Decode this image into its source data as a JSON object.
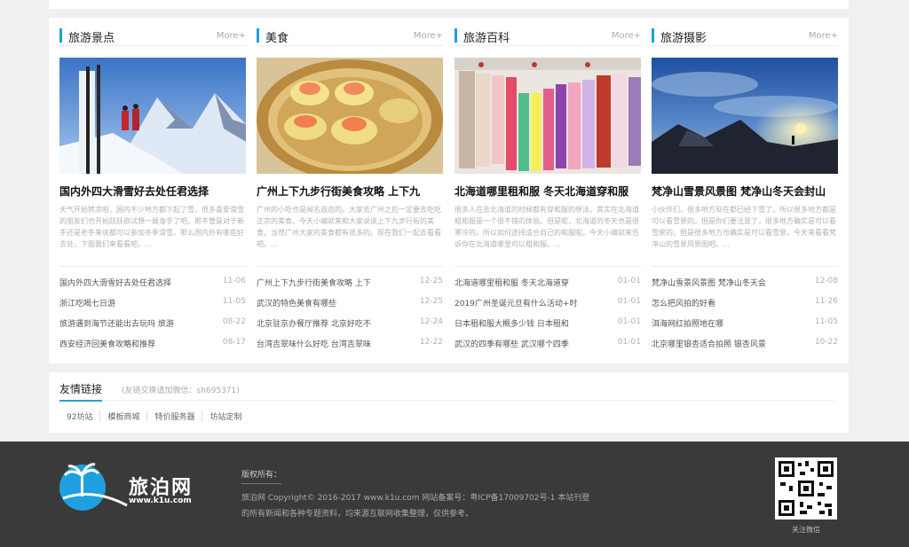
{
  "columns": [
    {
      "title": "旅游景点",
      "more": "More+",
      "headline": "国内外四大滑雪好去处任君选择",
      "summary": "天气开始转凉啦，国内不少地方都下起了雪，很多喜爱滑雪的朋友们也开始跃跃欲试想一展身手了吧。那不管是对于新手还是老手来说都可以参加冬季滑雪。那么国内外有哪些好去处，下面我们来看看吧。...",
      "list": [
        {
          "title": "国内外四大滑雪好去处任君选择",
          "date": "11-06"
        },
        {
          "title": "浙江吃喝七日游",
          "date": "11-05"
        },
        {
          "title": "旅游遇到海节还能出去玩吗 旅游",
          "date": "08-22"
        },
        {
          "title": "西安经济回美食攻略和推荐",
          "date": "08-17"
        }
      ]
    },
    {
      "title": "美食",
      "more": "More+",
      "headline": "广州上下九步行街美食攻略 上下九",
      "summary": "广州的小吃也是闻名遐迩的。大家去广州之后一定要去吃吃正宗的美食。今天小编就来和大家说说上下九步行街的美食。当然广州大家的美食都有很多的。现在我们一起去看看吧。...",
      "list": [
        {
          "title": "广州上下九步行街美食攻略 上下",
          "date": "12-25"
        },
        {
          "title": "武汉的特色美食有哪些",
          "date": "12-25"
        },
        {
          "title": "北京驻京办餐厅推荐 北京好吃不",
          "date": "12-24"
        },
        {
          "title": "台湾吉翠味什么好吃 台湾吉翠味",
          "date": "12-22"
        }
      ]
    },
    {
      "title": "旅游百科",
      "more": "More+",
      "headline": "北海道哪里租和服 冬天北海道穿和服",
      "summary": "很多人在去北海道的时候都有穿和服的想法。其实在北海道租和服是一个很不错的体验。但是呢，北海道的冬天也是很寒冷的。所以如何选择适合自己的和服呢。今天小编就来告诉你在北海道哪里可以租和服。...",
      "list": [
        {
          "title": "北海道哪里租和服 冬天北海道穿",
          "date": "01-01"
        },
        {
          "title": "2019广州圣诞元旦有什么活动+时",
          "date": "01-01"
        },
        {
          "title": "日本租和服大概多少钱 日本租和",
          "date": "01-01"
        },
        {
          "title": "武汉的四季有哪些 武汉哪个四季",
          "date": "01-01"
        }
      ]
    },
    {
      "title": "旅游摄影",
      "more": "More+",
      "headline": "梵净山雪景风景图 梵净山冬天会封山",
      "summary": "小伙伴们，很多地方现在都已经下雪了，所以很多地方都是可以看雪景的。但是你们要注意了，很多地方确实是可以看雪景的。但是很多地方也确实是可以看雪景。今天来看看梵净山的雪景风景图吧。...",
      "list": [
        {
          "title": "梵净山雪景风景图 梵净山冬天会",
          "date": "12-08"
        },
        {
          "title": "怎么把风拍的好看",
          "date": "11-26"
        },
        {
          "title": "洱海网红拍照地在哪",
          "date": "11-05"
        },
        {
          "title": "北京哪里银杏适合拍照 银杏风景",
          "date": "10-22"
        }
      ]
    }
  ],
  "links": {
    "title": "友情链接",
    "subtitle": "(友链交换请加微信：sh695371)",
    "items": [
      "92坊站",
      "模板商城",
      "特价服务器",
      "坊站定制"
    ]
  },
  "footer": {
    "logo_name": "旅泊网",
    "logo_url": "www.k1u.com",
    "copyright_heading": "版权所有：",
    "copyright_line1": "旅泊网 Copyright© 2016-2017 www.k1u.com 网站备案号：粤ICP备17009702号-1 本站刊登",
    "copyright_line2": "的所有新闻和各种专题资料，均来源互联网收集整理，仅供参考。",
    "qr_caption": "关注微信"
  }
}
